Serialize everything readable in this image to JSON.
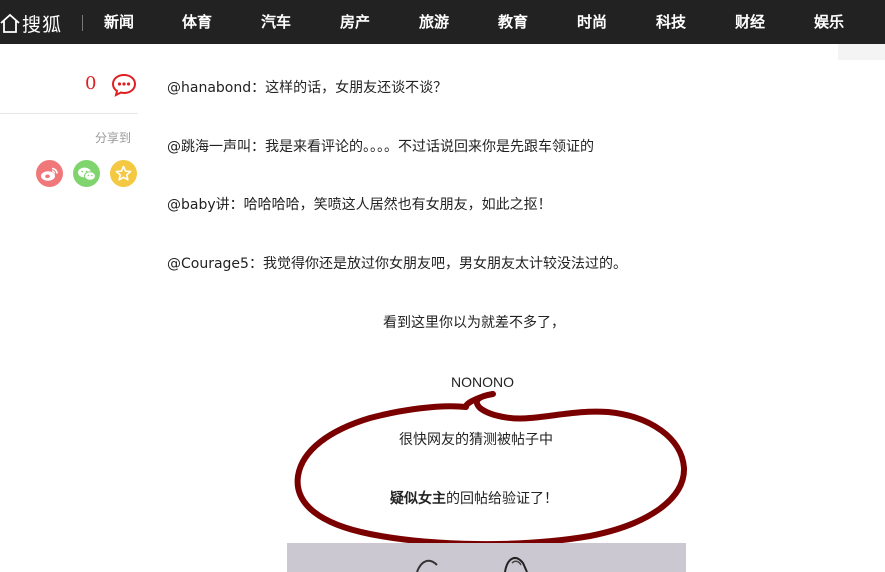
{
  "header": {
    "logo_text": "搜狐",
    "nav": [
      "新闻",
      "体育",
      "汽车",
      "房产",
      "旅游",
      "教育",
      "时尚",
      "科技",
      "财经",
      "娱乐"
    ]
  },
  "sidebar": {
    "comment_count": "0",
    "share_label": "分享到",
    "share_buttons": [
      "weibo-icon",
      "wechat-icon",
      "favorite-icon"
    ]
  },
  "article": {
    "comments": [
      "@hanabond：这样的话，女朋友还谈不谈？",
      "@跳海一声叫：我是来看评论的。。。。不过话说回来你是先跟车领证的",
      "@baby讲：哈哈哈哈，笑喷这人居然也有女朋友，如此之抠！",
      "@Courage5：我觉得你还是放过你女朋友吧，男女朋友太计较没法过的。"
    ],
    "line_think": "看到这里你以为就差不多了，",
    "line_nonono": "NONONO",
    "circle_line1": "很快网友的猜测被帖子中",
    "circle_line2_bold": "疑似女主",
    "circle_line2_rest": "的回帖给验证了！"
  },
  "colors": {
    "nav_bg": "#222222",
    "accent_red": "#e02020",
    "circle_stroke": "#7a0000",
    "weibo": "#f0787a",
    "wechat": "#7fd46e",
    "favorite": "#f5c842"
  }
}
